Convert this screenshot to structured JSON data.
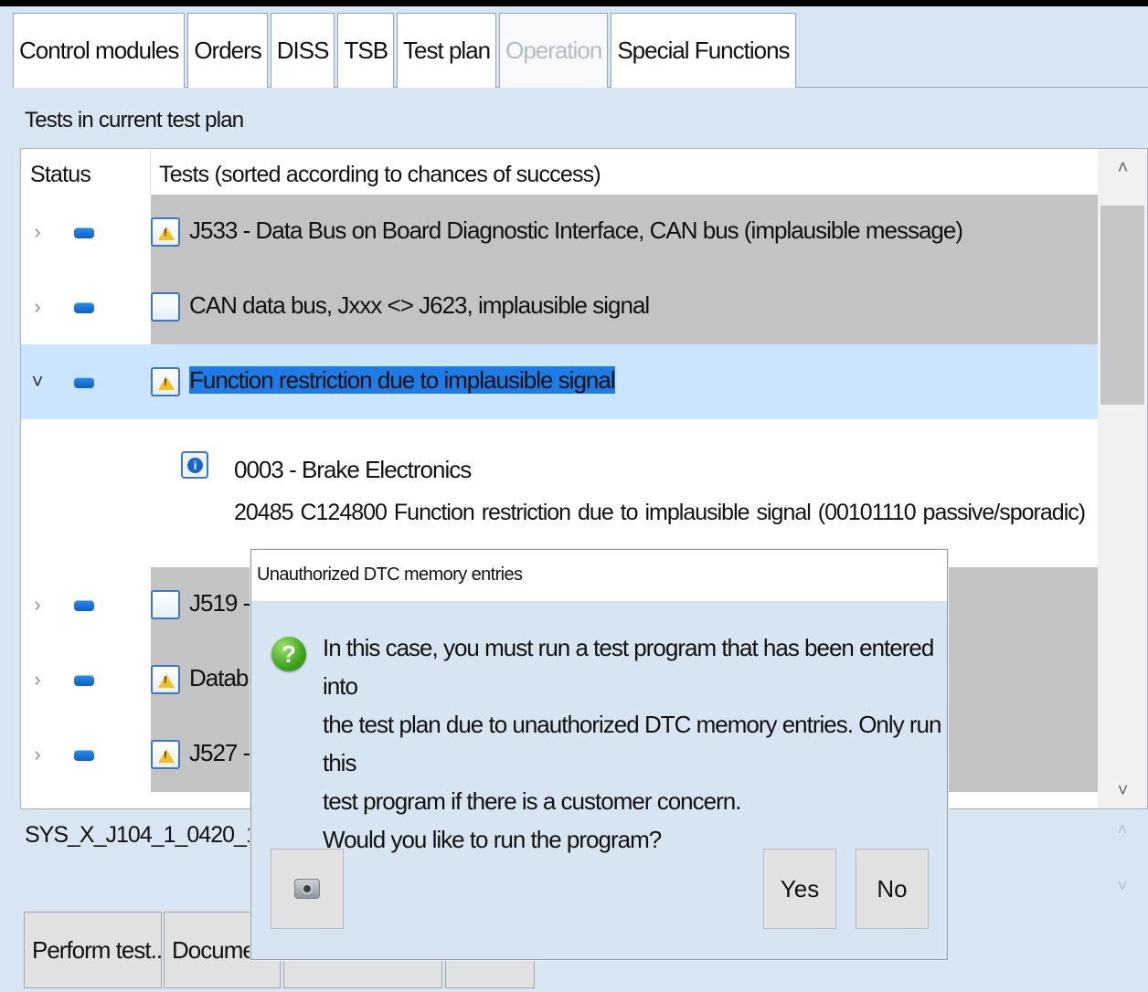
{
  "tabs": [
    {
      "label": "Control modules",
      "state": "normal"
    },
    {
      "label": "Orders",
      "state": "normal"
    },
    {
      "label": "DISS",
      "state": "normal"
    },
    {
      "label": "TSB",
      "state": "normal"
    },
    {
      "label": "Test plan",
      "state": "active"
    },
    {
      "label": "Operation",
      "state": "disabled"
    },
    {
      "label": "Special Functions",
      "state": "normal"
    }
  ],
  "section_label": "Tests in current test plan",
  "table": {
    "col_status": "Status",
    "col_tests": "Tests (sorted according to chances of success)",
    "rows": [
      {
        "text": "J533 - Data Bus on Board Diagnostic Interface, CAN bus (implausible message)",
        "icon": "warning-icon",
        "expanded": false
      },
      {
        "text": "CAN data bus, Jxxx <> J623, implausible signal",
        "icon": "blank-doc-icon",
        "expanded": false
      },
      {
        "text": "Function restriction due to implausible signal",
        "icon": "warning-icon",
        "expanded": true
      },
      {
        "text": "J519 -",
        "icon": "blank-doc-icon",
        "expanded": false
      },
      {
        "text": "Databu",
        "icon": "warning-icon",
        "expanded": false
      },
      {
        "text": "J527 -",
        "icon": "warning-icon",
        "expanded": false
      }
    ],
    "detail": {
      "title": "0003 - Brake Electronics",
      "line": "20485   C124800   Function restriction due to implausible signal  (00101110   passive/sporadic)"
    }
  },
  "sys_label": "SYS_X_J104_1_0420_1",
  "bottom_buttons": {
    "perform": "Perform test...",
    "document": "Docume"
  },
  "dialog": {
    "title": "Unauthorized DTC memory entries",
    "message_lines": [
      "In this case, you must run a test program that has been entered into",
      "the test plan due to unauthorized DTC memory entries. Only run this",
      "test program if there is a customer concern.",
      "Would you like to run the program?"
    ],
    "yes": "Yes",
    "no": "No"
  },
  "icons": {
    "expanded": "chevron-down-icon",
    "collapsed": "chevron-right-icon",
    "question": "question-icon",
    "camera": "camera-icon"
  },
  "colors": {
    "selection": "#cce5ff",
    "highlight": "#1e7ce6",
    "row_gray": "#c3c3c3",
    "background": "#d8e5f2"
  }
}
